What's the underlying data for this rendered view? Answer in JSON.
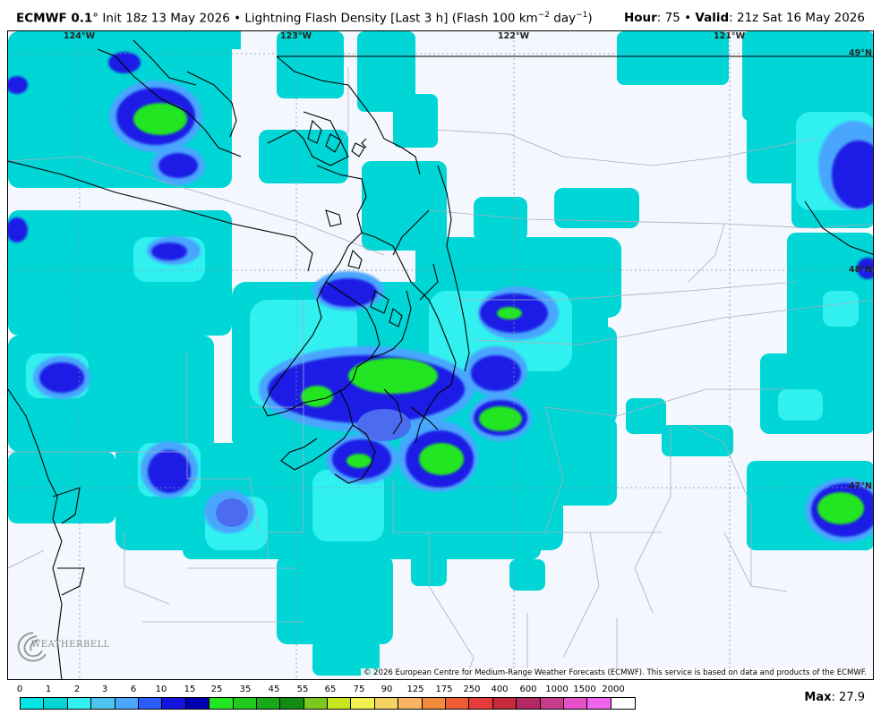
{
  "header": {
    "model": "ECMWF 0.1",
    "degree": "°",
    "init": "Init 18z 13 May 2026",
    "bullet": "•",
    "product": "Lightning Flash Density [Last 3 h] (Flash 100 km",
    "exp1": "−2",
    "unit_mid": " day",
    "exp2": "−1",
    "unit_end": ")",
    "hour_label": "Hour",
    "hour_value": ": 75",
    "valid_label": "Valid",
    "valid_value": ": 21z Sat 16 May 2026"
  },
  "map": {
    "longitudes": [
      "124°W",
      "123°W",
      "122°W",
      "121°W"
    ],
    "latitudes": [
      "49°N",
      "48°N",
      "47°N"
    ],
    "copyright": "© 2026 European Centre for Medium-Range Weather Forecasts (ECMWF). This service is based on data and products of the ECMWF.",
    "logo_text": "WEATHERBELL",
    "colors": {
      "background": "#f4f7fd",
      "cyan": "#00d6d6",
      "light_cyan": "#30f0f0",
      "light_blue": "#4aa6ff",
      "blue": "#2a5cff",
      "dark_blue": "#1414e0",
      "green": "#22e622",
      "coast": "#000000",
      "borders": "#9aa0b0"
    }
  },
  "legend": {
    "labels": [
      "0",
      "1",
      "2",
      "3",
      "6",
      "10",
      "15",
      "25",
      "35",
      "45",
      "55",
      "65",
      "75",
      "90",
      "125",
      "175",
      "250",
      "400",
      "600",
      "1000",
      "1500",
      "2000"
    ],
    "colors": [
      "#00e6e6",
      "#00d4d4",
      "#30f0f0",
      "#4cc4f0",
      "#4aa6ff",
      "#2a5cff",
      "#1414e0",
      "#0000b0",
      "#22e622",
      "#1ec81e",
      "#18a818",
      "#148c14",
      "#7cc81e",
      "#c8e61e",
      "#f0f050",
      "#f5d264",
      "#fab464",
      "#f08c3c",
      "#f05a32",
      "#e63c3c",
      "#c8283c",
      "#b42864",
      "#c83c8c",
      "#e650c8",
      "#f064f0",
      "#ffffff"
    ],
    "max_label": "Max",
    "max_value": ": 27.9"
  }
}
